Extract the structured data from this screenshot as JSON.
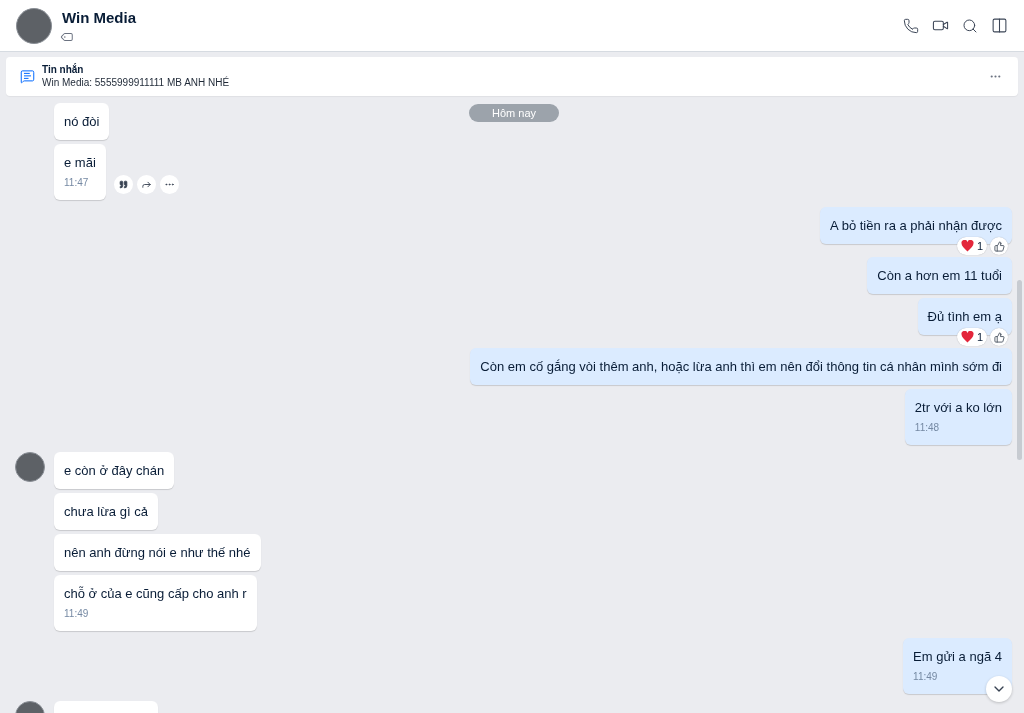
{
  "header": {
    "name": "Win Media"
  },
  "pinned": {
    "label": "Tin nhắn",
    "message": "Win Media: 5555999911111 MB ANH NHÉ"
  },
  "date_pill": "Hôm nay",
  "messages": [
    {
      "kind": "incoming",
      "avatar": false,
      "text": "nó đòi",
      "hovered": false
    },
    {
      "kind": "incoming",
      "avatar": false,
      "text": "e mãi",
      "time": "11:47",
      "hovered": true
    },
    {
      "kind": "outgoing",
      "text": "A bỏ tiền ra a phải nhận được",
      "reaction_count": "1",
      "hovered": false
    },
    {
      "kind": "outgoing",
      "text": "Còn a hơn em 11 tuổi",
      "hovered": false
    },
    {
      "kind": "outgoing",
      "text": "Đủ tình em ạ",
      "reaction_count": "1",
      "hovered": false
    },
    {
      "kind": "outgoing",
      "text": "Còn em cố gắng vòi thêm anh, hoặc lừa anh thì em nên đổi thông tin cá nhân mình sớm đi",
      "hovered": false
    },
    {
      "kind": "outgoing",
      "text": "2tr với a ko lớn",
      "time": "11:48",
      "hovered": false
    },
    {
      "kind": "incoming",
      "avatar": true,
      "text": "e còn ở đây chán",
      "hovered": false
    },
    {
      "kind": "incoming",
      "avatar": false,
      "text": "chưa lừa gì cả",
      "hovered": false
    },
    {
      "kind": "incoming",
      "avatar": false,
      "text": "nên anh đừng nói e như thế nhé",
      "hovered": false
    },
    {
      "kind": "incoming",
      "avatar": false,
      "text": "chỗ ở của e cũng cấp cho anh r",
      "time": "11:49",
      "hovered": false
    },
    {
      "kind": "outgoing",
      "text": "Em gửi a ngã 4",
      "time": "11:49",
      "hovered": false
    },
    {
      "kind": "incoming",
      "avatar": true,
      "hovered": false
    }
  ]
}
